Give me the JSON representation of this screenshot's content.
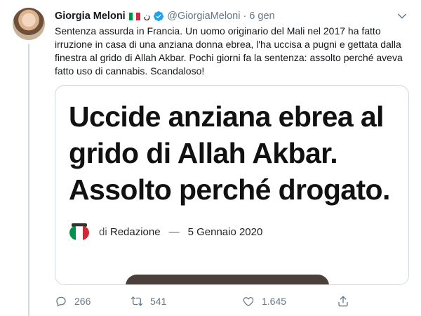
{
  "tweet": {
    "author_name": "Giorgia Meloni",
    "arabic_symbol": "ن",
    "handle": "@GiorgiaMeloni",
    "separator": "·",
    "date": "6 gen",
    "text": "Sentenza assurda in Francia. Un uomo originario del Mali nel 2017 ha fatto irruzione in casa di una anziana donna ebrea, l'ha uccisa a pugni e gettata dalla finestra al grido di Allah Akbar. Pochi giorni fa la sentenza: assolto perché aveva fatto uso di cannabis. Scandaloso!"
  },
  "card": {
    "headline": "Uccide anziana ebrea al grido di Allah Akbar. Assolto perché drogato.",
    "by_prefix": "di",
    "author": "Redazione",
    "dash": "—",
    "pub_date": "5 Gennaio 2020"
  },
  "actions": {
    "replies": "266",
    "retweets": "541",
    "likes": "1.645"
  },
  "colors": {
    "flag_green": "#009246",
    "flag_white": "#ffffff",
    "flag_red": "#ce2b37",
    "verified_blue": "#1da1f2",
    "muted": "#657786"
  },
  "icons": [
    "verified-badge-icon",
    "chevron-down-icon",
    "reply-icon",
    "retweet-icon",
    "like-icon",
    "share-icon"
  ]
}
